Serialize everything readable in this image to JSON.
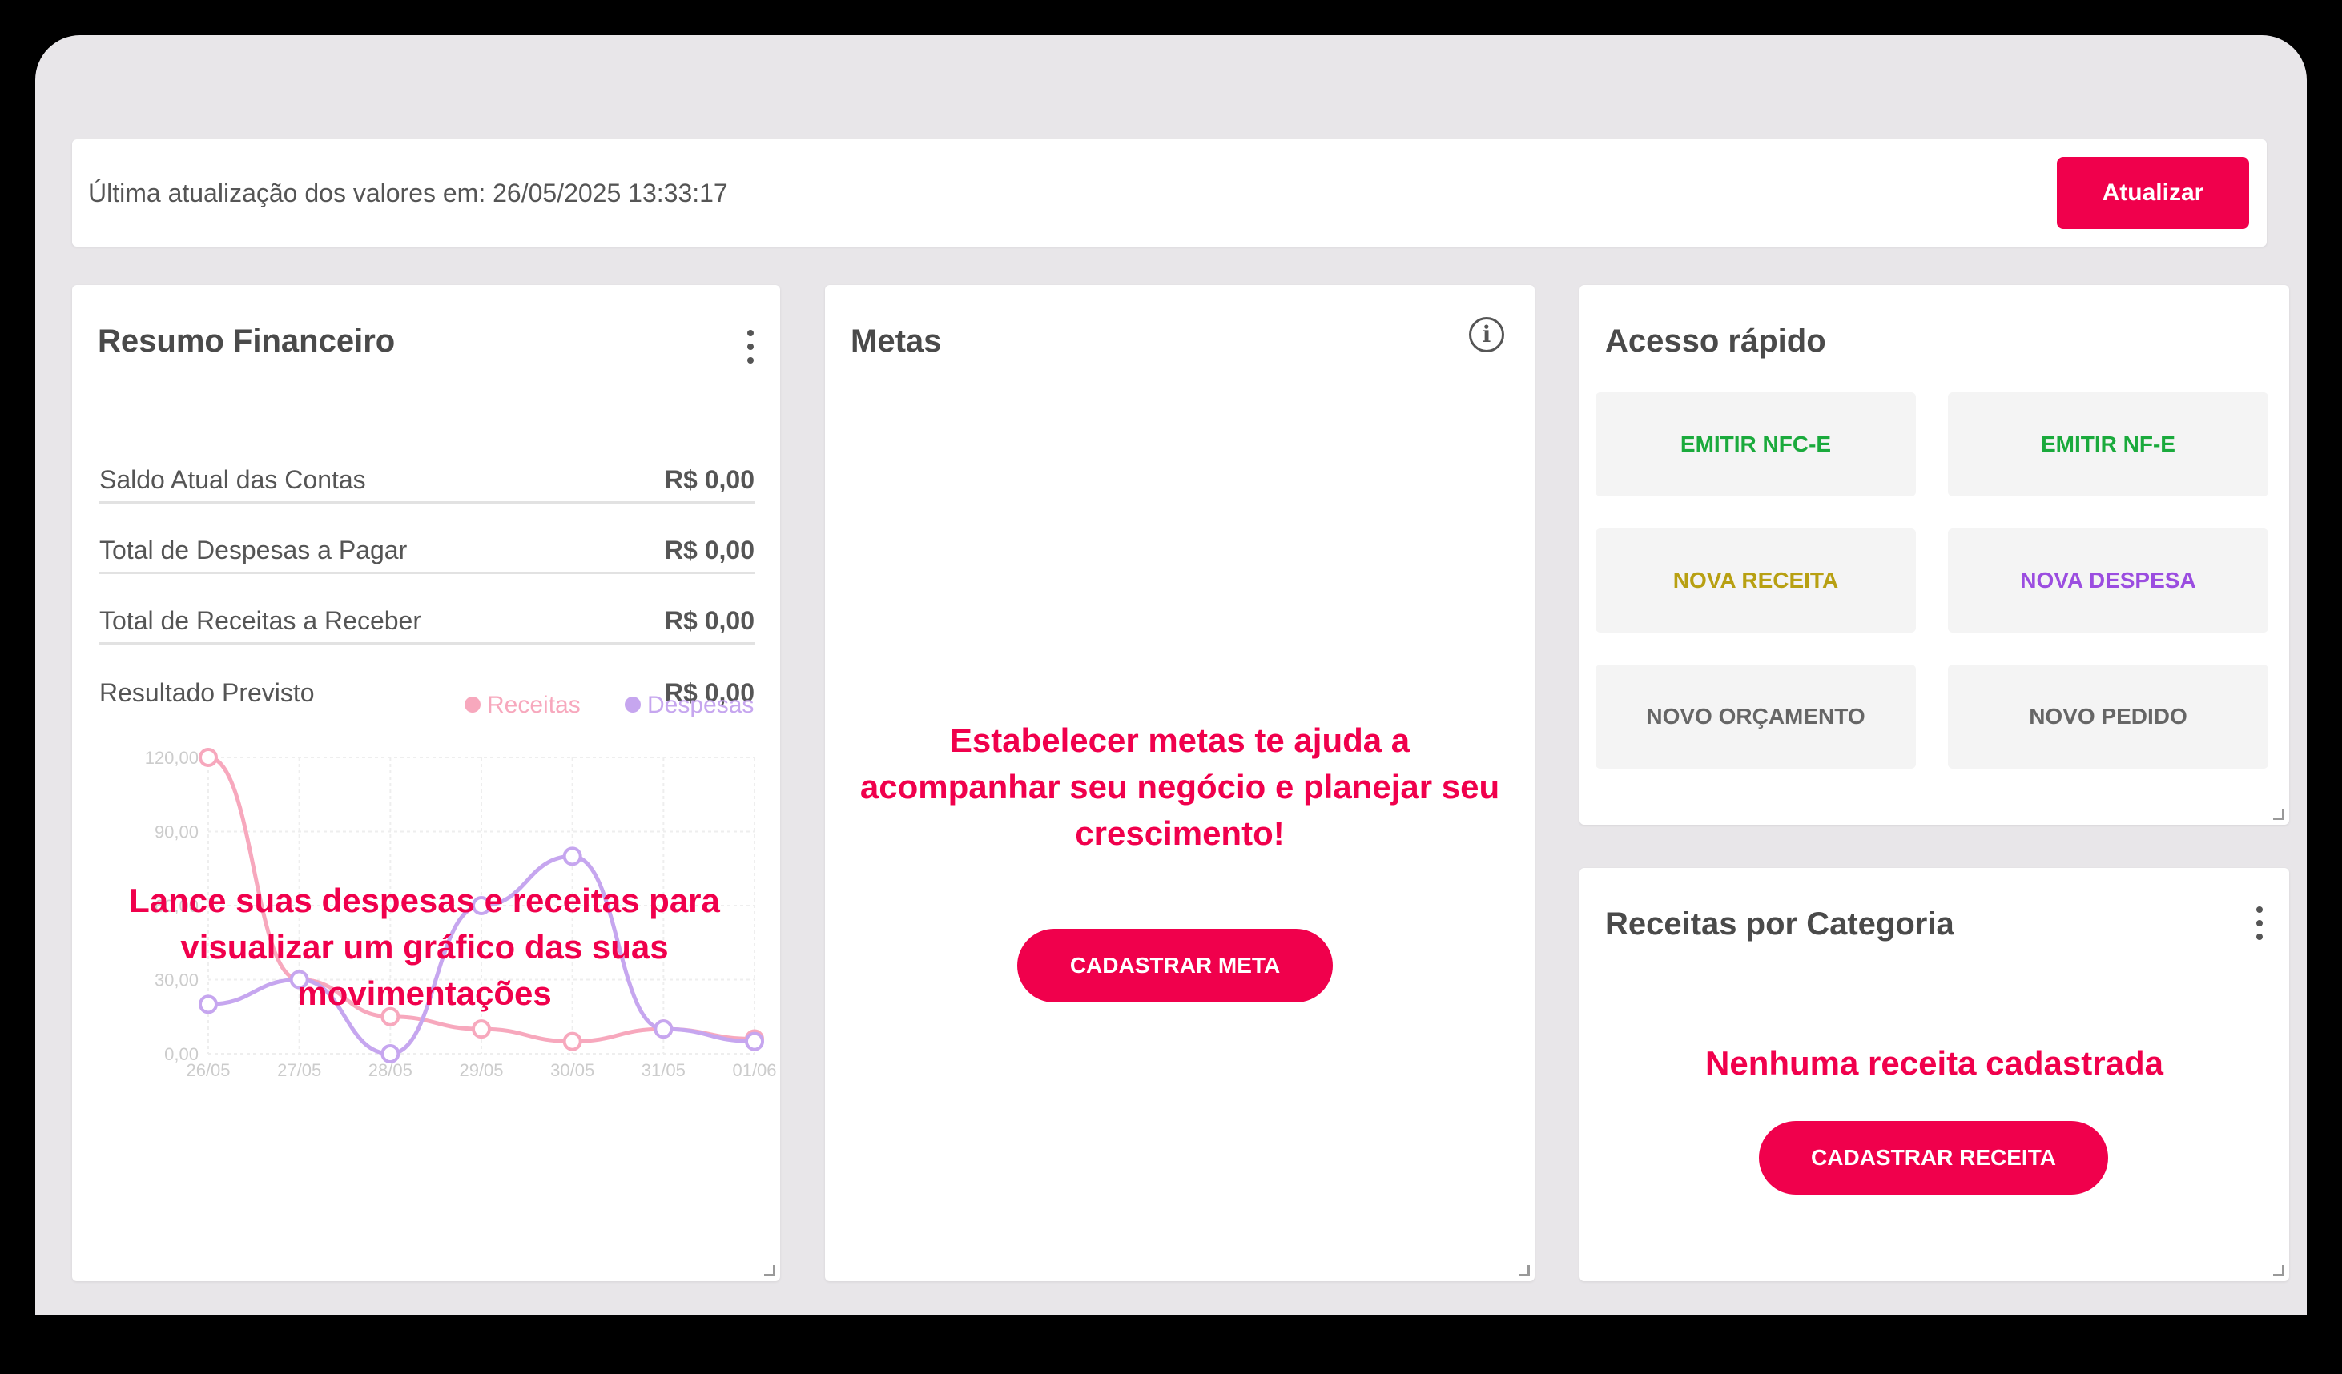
{
  "header": {
    "last_update": "Última atualização dos valores em: 26/05/2025 13:33:17",
    "update_label": "Atualizar"
  },
  "resumo": {
    "title": "Resumo Financeiro",
    "rows": [
      {
        "label": "Saldo Atual das Contas",
        "value": "R$ 0,00"
      },
      {
        "label": "Total de Despesas a Pagar",
        "value": "R$ 0,00"
      },
      {
        "label": "Total de Receitas a Receber",
        "value": "R$ 0,00"
      },
      {
        "label": "Resultado Previsto",
        "value": "R$ 0,00"
      }
    ],
    "overlay": "Lance suas despesas e receitas para visualizar um gráfico das suas movimentações"
  },
  "chart_data": {
    "type": "line",
    "categories": [
      "26/05",
      "27/05",
      "28/05",
      "29/05",
      "30/05",
      "31/05",
      "01/06"
    ],
    "y_ticks": [
      "0,00",
      "30,00",
      "60,00",
      "90,00",
      "120,00"
    ],
    "ylim": [
      0,
      120
    ],
    "grid": true,
    "legend_position": "top-right",
    "series": [
      {
        "name": "Receitas",
        "color": "#f7a8bd",
        "values": [
          120,
          30,
          15,
          10,
          5,
          10,
          6
        ]
      },
      {
        "name": "Despesas",
        "color": "#c6a6ef",
        "values": [
          20,
          30,
          0,
          60,
          80,
          10,
          5
        ]
      }
    ]
  },
  "metas": {
    "title": "Metas",
    "message": "Estabelecer metas te ajuda a acompanhar seu negócio e planejar seu crescimento!",
    "button": "CADASTRAR META"
  },
  "acesso": {
    "title": "Acesso rápido",
    "buttons": [
      {
        "label": "EMITIR NFC-E",
        "color": "#1aaa3c"
      },
      {
        "label": "EMITIR NF-E",
        "color": "#1aaa3c"
      },
      {
        "label": "NOVA RECEITA",
        "color": "#b8a012"
      },
      {
        "label": "NOVA DESPESA",
        "color": "#9b4de0"
      },
      {
        "label": "NOVO ORÇAMENTO",
        "color": "#666666"
      },
      {
        "label": "NOVO PEDIDO",
        "color": "#666666"
      }
    ]
  },
  "receitas": {
    "title": "Receitas por Categoria",
    "message": "Nenhuma receita cadastrada",
    "button": "CADASTRAR RECEITA"
  },
  "colors": {
    "accent": "#f0004c",
    "background": "#e8e6e9"
  }
}
